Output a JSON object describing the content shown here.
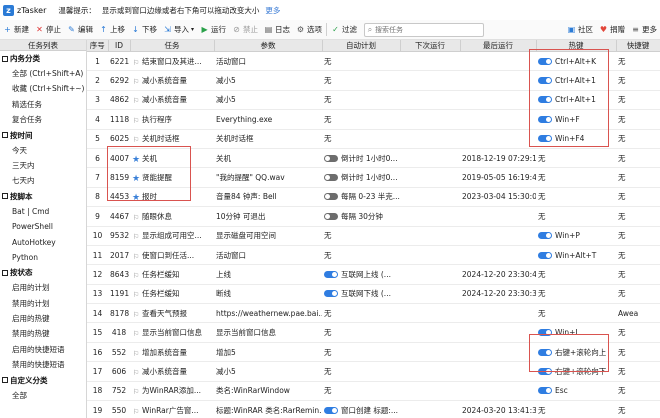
{
  "window": {
    "app_title": "zTasker",
    "tip_label": "温馨提示：",
    "tip_text": "显示或到窗口边缘或者右下角可以拖动改变大小",
    "tip_more": "更多"
  },
  "toolbar": {
    "new": "新建",
    "stop": "停止",
    "edit": "编辑",
    "up": "上移",
    "down": "下移",
    "import": "导入",
    "run": "运行",
    "forbid": "禁止",
    "log": "日志",
    "options": "选项",
    "filter": "过滤",
    "search_placeholder": "搜索任务",
    "community": "社区",
    "donate": "捐赠",
    "more": "更多"
  },
  "sidebar": {
    "header": "任务列表",
    "groups": [
      {
        "title": "内务分类",
        "items": [
          "全部 (Ctrl+Shift+A)",
          "收藏 (Ctrl+Shift+~)",
          "精选任务",
          "复合任务"
        ]
      },
      {
        "title": "按时间",
        "items": [
          "今天",
          "三天内",
          "七天内"
        ]
      },
      {
        "title": "按脚本",
        "items": [
          "Bat | Cmd",
          "PowerShell",
          "AutoHotkey",
          "Python"
        ]
      },
      {
        "title": "按状态",
        "items": [
          "启用的计划",
          "禁用的计划",
          "启用的热键",
          "禁用的热键",
          "启用的快捷短语",
          "禁用的快捷短语"
        ]
      },
      {
        "title": "自定义分类",
        "items": [
          "全部"
        ]
      }
    ]
  },
  "columns": [
    "序号",
    "ID",
    "任务",
    "参数",
    "自动计划",
    "下次运行",
    "最后运行",
    "热键",
    "快捷键"
  ],
  "rows": [
    {
      "seq": "1",
      "id": "6221",
      "flag": "none",
      "task": "结束窗口及其进...",
      "param": "活动窗口",
      "plan_toggle": "",
      "plan": "无",
      "next": "",
      "last": "",
      "hk_toggle": "on",
      "hotkey": "Ctrl+Alt+K",
      "shortcut": "无"
    },
    {
      "seq": "2",
      "id": "6292",
      "flag": "none",
      "task": "减小系统音量",
      "param": "减小5",
      "plan_toggle": "",
      "plan": "无",
      "next": "",
      "last": "",
      "hk_toggle": "on",
      "hotkey": "Ctrl+Alt+1",
      "shortcut": "无"
    },
    {
      "seq": "3",
      "id": "4862",
      "flag": "none",
      "task": "减小系统音量",
      "param": "减小5",
      "plan_toggle": "",
      "plan": "无",
      "next": "",
      "last": "",
      "hk_toggle": "on",
      "hotkey": "Ctrl+Alt+1",
      "shortcut": "无"
    },
    {
      "seq": "4",
      "id": "1118",
      "flag": "none",
      "task": "执行程序",
      "param": "Everything.exe",
      "plan_toggle": "",
      "plan": "无",
      "next": "",
      "last": "",
      "hk_toggle": "on",
      "hotkey": "Win+F",
      "shortcut": "无"
    },
    {
      "seq": "5",
      "id": "6025",
      "flag": "none",
      "task": "关机时话框",
      "param": "关机时话框",
      "plan_toggle": "",
      "plan": "无",
      "next": "",
      "last": "",
      "hk_toggle": "on",
      "hotkey": "Win+F4",
      "shortcut": "无"
    },
    {
      "seq": "6",
      "id": "4007",
      "flag": "star",
      "task": "关机",
      "param": "关机",
      "plan_toggle": "off",
      "plan": "倒计时 1小时0...",
      "next": "",
      "last": "2018-12-19 07:29:18",
      "hk_toggle": "",
      "hotkey": "无",
      "shortcut": "无"
    },
    {
      "seq": "7",
      "id": "8159",
      "flag": "star",
      "task": "贤能提醒",
      "param": "\"我的提醒\" QQ.wav",
      "plan_toggle": "off",
      "plan": "倒计时 1小时0...",
      "next": "",
      "last": "2019-05-05 16:19:41",
      "hk_toggle": "",
      "hotkey": "无",
      "shortcut": "无"
    },
    {
      "seq": "8",
      "id": "4453",
      "flag": "star",
      "task": "报时",
      "param": "音量84 钟声: Bell",
      "plan_toggle": "off",
      "plan": "每隔 0-23 半克...",
      "next": "",
      "last": "2023-03-04 15:30:00",
      "hk_toggle": "",
      "hotkey": "无",
      "shortcut": "无"
    },
    {
      "seq": "9",
      "id": "4467",
      "flag": "none",
      "task": "随眼休息",
      "param": "10分钟 可退出",
      "plan_toggle": "off",
      "plan": "每隔 30分钟",
      "next": "",
      "last": "",
      "hk_toggle": "",
      "hotkey": "无",
      "shortcut": "无"
    },
    {
      "seq": "10",
      "id": "9532",
      "flag": "none",
      "task": "显示组成可用空...",
      "param": "显示磁盘可用空间",
      "plan_toggle": "",
      "plan": "无",
      "next": "",
      "last": "",
      "hk_toggle": "on",
      "hotkey": "Win+P",
      "shortcut": "无"
    },
    {
      "seq": "11",
      "id": "2017",
      "flag": "none",
      "task": "使窗口到任活...",
      "param": "活动窗口",
      "plan_toggle": "",
      "plan": "无",
      "next": "",
      "last": "",
      "hk_toggle": "on",
      "hotkey": "Win+Alt+T",
      "shortcut": "无"
    },
    {
      "seq": "12",
      "id": "8643",
      "flag": "none",
      "task": "任务栏缓知",
      "param": "上线",
      "plan_toggle": "on",
      "plan": "互联网上线 (...",
      "next": "",
      "last": "2024-12-20 23:30:44",
      "hk_toggle": "",
      "hotkey": "无",
      "shortcut": "无"
    },
    {
      "seq": "13",
      "id": "1191",
      "flag": "none",
      "task": "任务栏缓知",
      "param": "断线",
      "plan_toggle": "on",
      "plan": "互联网下线 (...",
      "next": "",
      "last": "2024-12-20 23:30:30",
      "hk_toggle": "",
      "hotkey": "无",
      "shortcut": "无"
    },
    {
      "seq": "14",
      "id": "8178",
      "flag": "none",
      "task": "查看天气预报",
      "param": "https://weathernew.pae.bai...",
      "plan_toggle": "",
      "plan": "无",
      "next": "",
      "last": "",
      "hk_toggle": "",
      "hotkey": "无",
      "shortcut": "Awea"
    },
    {
      "seq": "15",
      "id": "418",
      "flag": "none",
      "task": "显示当前窗口信息",
      "param": "显示当前窗口信息",
      "plan_toggle": "",
      "plan": "无",
      "next": "",
      "last": "",
      "hk_toggle": "on",
      "hotkey": "Win+I",
      "shortcut": "无"
    },
    {
      "seq": "16",
      "id": "552",
      "flag": "none",
      "task": "增加系统音量",
      "param": "增加5",
      "plan_toggle": "",
      "plan": "无",
      "next": "",
      "last": "",
      "hk_toggle": "on",
      "hotkey": "右键+滚轮向上",
      "shortcut": "无"
    },
    {
      "seq": "17",
      "id": "606",
      "flag": "none",
      "task": "减小系统音量",
      "param": "减小5",
      "plan_toggle": "",
      "plan": "无",
      "next": "",
      "last": "",
      "hk_toggle": "on",
      "hotkey": "右键+滚轮向下",
      "shortcut": "无"
    },
    {
      "seq": "18",
      "id": "752",
      "flag": "none",
      "task": "为WinRAR添加...",
      "param": "类名:WinRarWindow",
      "plan_toggle": "",
      "plan": "无",
      "next": "",
      "last": "",
      "hk_toggle": "on",
      "hotkey": "Esc",
      "shortcut": "无"
    },
    {
      "seq": "19",
      "id": "550",
      "flag": "none",
      "task": "WinRar广告窗...",
      "param": "标题:WinRAR 类名:RarRemin...",
      "plan_toggle": "on",
      "plan": "窗口创建 标题:...",
      "next": "",
      "last": "2024-03-20 13:41:33",
      "hk_toggle": "",
      "hotkey": "无",
      "shortcut": "无"
    }
  ],
  "colors": {
    "accent": "#2f7de1",
    "toggle_off": "#6d6d6d",
    "highlight": "#d9534f"
  }
}
